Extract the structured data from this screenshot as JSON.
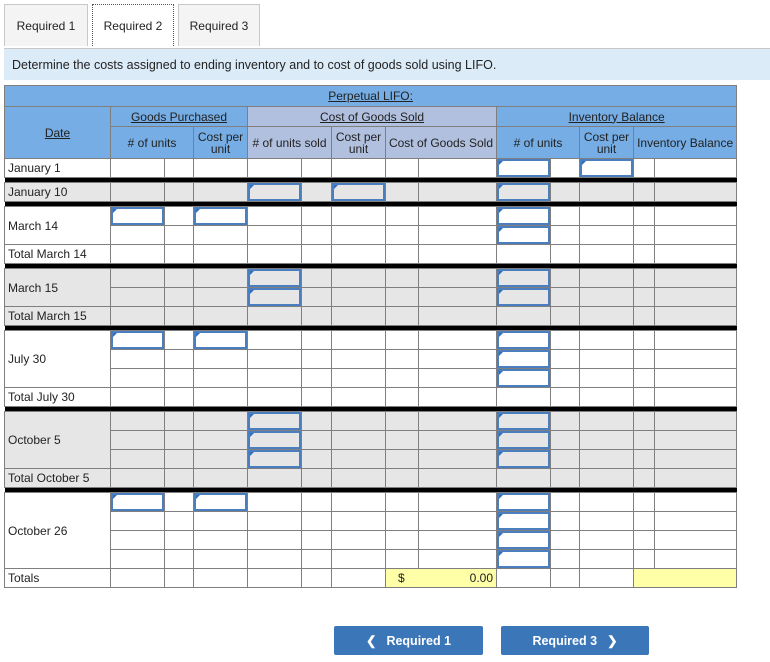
{
  "tabs": [
    {
      "label": "Required 1"
    },
    {
      "label": "Required 2"
    },
    {
      "label": "Required 3"
    }
  ],
  "instruction": "Determine the costs assigned to ending inventory and to cost of goods sold using LIFO.",
  "table": {
    "title": "Perpetual LIFO:",
    "date_header": "Date",
    "groups": {
      "purchased": "Goods Purchased",
      "cogs": "Cost of Goods Sold",
      "inventory": "Inventory Balance"
    },
    "cols": {
      "gp_units": "# of units",
      "gp_cost": "Cost per unit",
      "cogs_units": "# of units sold",
      "cogs_cost": "Cost per unit",
      "cogs_total": "Cost of Goods Sold",
      "inv_units": "# of units",
      "inv_cost": "Cost per unit",
      "inv_total": "Inventory Balance"
    },
    "rows": [
      "January 1",
      "January 10",
      "March 14",
      "Total March 14",
      "March 15",
      "Total March 15",
      "July 30",
      "Total July 30",
      "October 5",
      "Total October 5",
      "October 26",
      "Totals"
    ],
    "totals": {
      "currency": "$",
      "cogs_value": "0.00"
    }
  },
  "buttons": {
    "prev": "Required 1",
    "next": "Required 3"
  }
}
